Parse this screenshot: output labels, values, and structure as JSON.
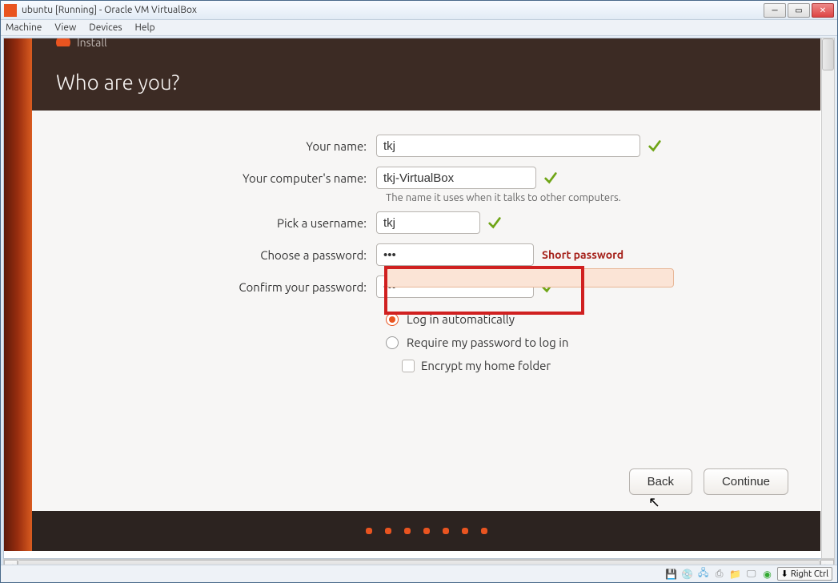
{
  "window": {
    "title": "ubuntu [Running] - Oracle VM VirtualBox",
    "menus": [
      "Machine",
      "View",
      "Devices",
      "Help"
    ],
    "hostkey": "Right Ctrl"
  },
  "installer": {
    "header_tag": "Install",
    "title": "Who are you?",
    "labels": {
      "name": "Your name:",
      "computer": "Your computer's name:",
      "username": "Pick a username:",
      "password": "Choose a password:",
      "confirm": "Confirm your password:"
    },
    "values": {
      "name": "tkj",
      "computer": "tkj-VirtualBox",
      "username": "tkj",
      "password": "•••",
      "confirm": "•••"
    },
    "computer_help": "The name it uses when it talks to other computers.",
    "password_warn": "Short password",
    "options": {
      "auto": "Log in automatically",
      "require": "Require my password to log in",
      "encrypt": "Encrypt my home folder"
    },
    "buttons": {
      "back": "Back",
      "continue": "Continue"
    }
  },
  "colors": {
    "accent": "#e95420",
    "warn": "#a52019",
    "highlight_border": "#d02020"
  }
}
